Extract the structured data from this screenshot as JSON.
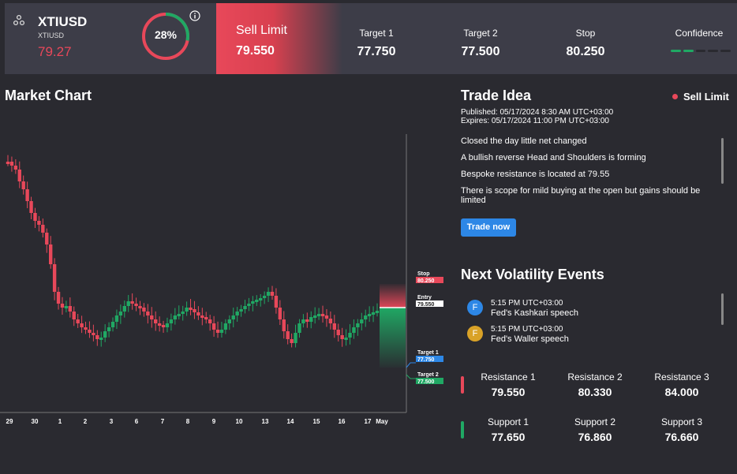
{
  "header": {
    "symbol": "XTIUSD",
    "symbol_sub": "XTIUSD",
    "price": "79.27",
    "confidence_pct": "28%",
    "confidence_value": 0.28,
    "sell_title": "Sell Limit",
    "sell_value": "79.550",
    "target1_label": "Target 1",
    "target1_value": "77.750",
    "target2_label": "Target 2",
    "target2_value": "77.500",
    "stop_label": "Stop",
    "stop_value": "80.250",
    "confidence_label": "Confidence",
    "confidence_segments": [
      true,
      true,
      false,
      false,
      false
    ],
    "colors": {
      "sell": "#e8485a",
      "buy": "#20a864",
      "accent": "#2d87e6"
    }
  },
  "chart": {
    "title": "Market Chart",
    "x_ticks": [
      "29",
      "30",
      "1",
      "2",
      "3",
      "6",
      "7",
      "8",
      "9",
      "10",
      "13",
      "14",
      "15",
      "16",
      "17",
      "May"
    ],
    "markers": [
      {
        "label": "Stop",
        "value": "80.250"
      },
      {
        "label": "Entry",
        "value": "79.550"
      },
      {
        "label": "Target 1",
        "value": "77.750"
      },
      {
        "label": "Target 2",
        "value": "77.500"
      }
    ]
  },
  "trade_idea": {
    "title": "Trade Idea",
    "tag": "Sell Limit",
    "published": "Published: 05/17/2024 8:30 AM UTC+03:00",
    "expires": "Expires: 05/17/2024 11:00 PM UTC+03:00",
    "lines": [
      "Closed the day little net changed",
      "A bullish reverse Head and Shoulders is forming",
      "Bespoke resistance is located at 79.55",
      "There is scope for mild buying at the open but gains should be limited"
    ],
    "button": "Trade now"
  },
  "events": {
    "title": "Next Volatility Events",
    "items": [
      {
        "icon": "F",
        "time": "5:15 PM UTC+03:00",
        "title": "Fed's Kashkari speech",
        "color": "#2d87e6"
      },
      {
        "icon": "F",
        "time": "5:15 PM UTC+03:00",
        "title": "Fed's Waller speech",
        "color": "#d9a227"
      }
    ]
  },
  "levels": {
    "resistance": [
      {
        "label": "Resistance 1",
        "value": "79.550"
      },
      {
        "label": "Resistance 2",
        "value": "80.330"
      },
      {
        "label": "Resistance 3",
        "value": "84.000"
      }
    ],
    "support": [
      {
        "label": "Support 1",
        "value": "77.650"
      },
      {
        "label": "Support 2",
        "value": "76.860"
      },
      {
        "label": "Support 3",
        "value": "76.660"
      }
    ]
  }
}
